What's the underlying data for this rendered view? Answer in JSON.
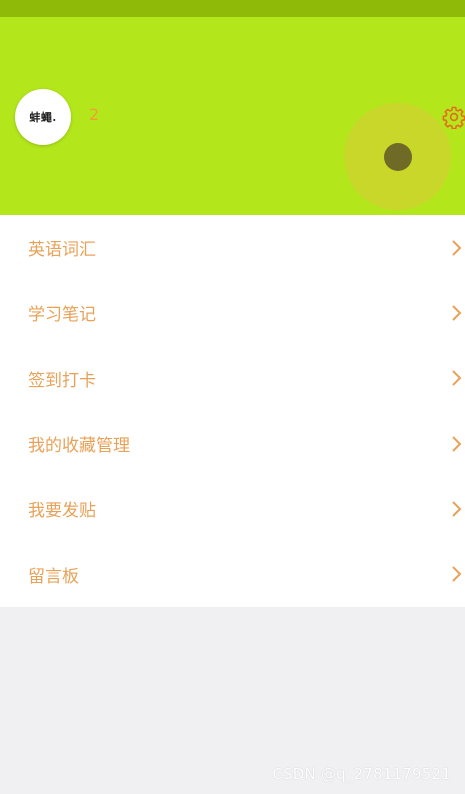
{
  "header": {
    "avatar_text": "蚌蠅.",
    "username": "2",
    "settings_icon": "gear-icon"
  },
  "menu": {
    "items": [
      {
        "label": "英语词汇"
      },
      {
        "label": "学习笔记"
      },
      {
        "label": "签到打卡"
      },
      {
        "label": "我的收藏管理"
      },
      {
        "label": "我要发贴"
      },
      {
        "label": "留言板"
      }
    ],
    "chevron_icon": "chevron-right-icon"
  },
  "watermark": "CSDN @q_2781179521",
  "colors": {
    "header_bg": "#b3e61b",
    "status_bar_bg": "#8fbb08",
    "menu_text": "#e8a258",
    "username_text": "#f0a032",
    "gear": "#e86a20",
    "page_bg": "#f0eff1"
  }
}
